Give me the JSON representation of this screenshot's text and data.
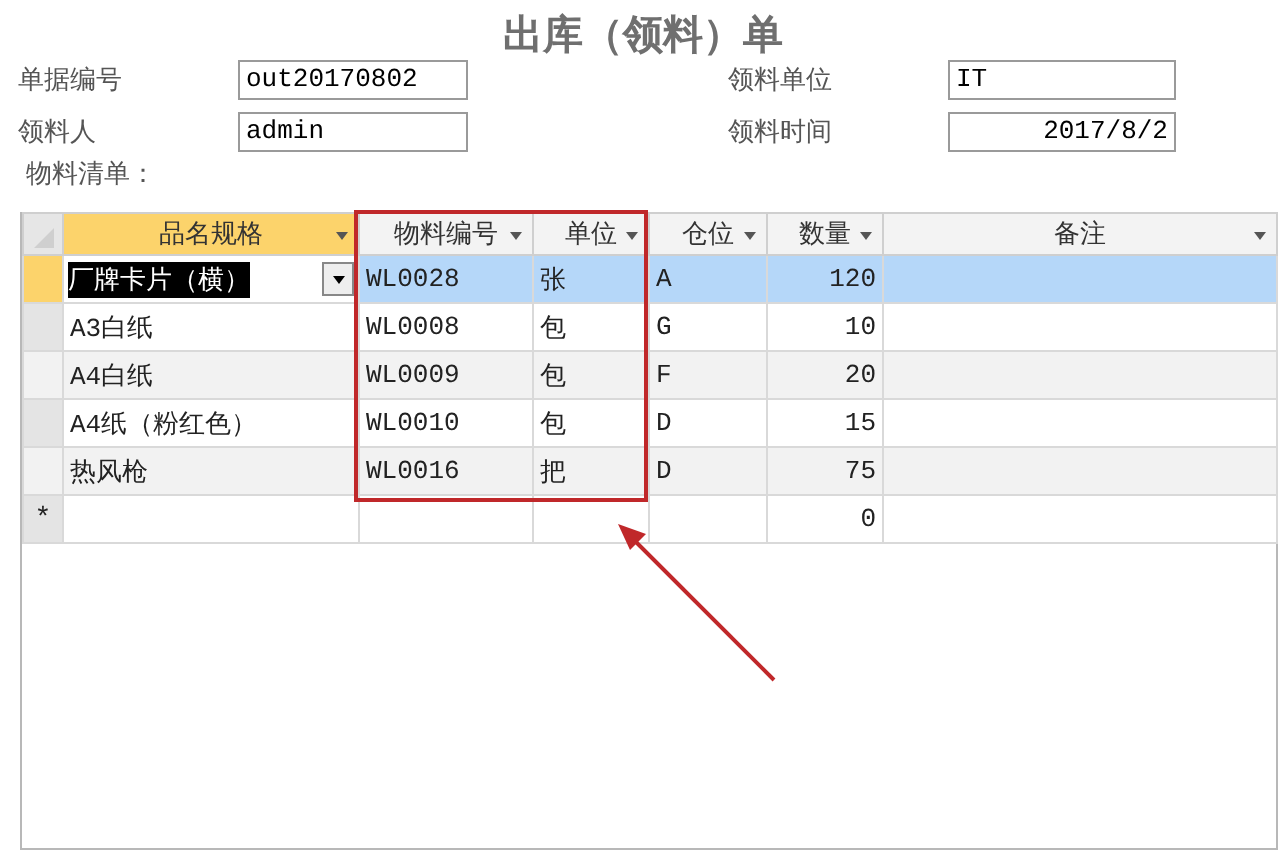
{
  "title": "出库（领料）单",
  "fields": [
    {
      "label": "单据编号",
      "value": "out20170802",
      "numeric": false
    },
    {
      "label": "领料单位",
      "value": "IT",
      "numeric": false
    },
    {
      "label": "领料人",
      "value": "admin",
      "numeric": false
    },
    {
      "label": "领料时间",
      "value": "2017/8/2",
      "numeric": true
    }
  ],
  "list_label": "物料清单：",
  "table": {
    "columns": [
      {
        "label": "品名规格",
        "active": true
      },
      {
        "label": "物料编号",
        "active": false
      },
      {
        "label": "单位",
        "active": false
      },
      {
        "label": "仓位",
        "active": false
      },
      {
        "label": "数量",
        "active": false
      },
      {
        "label": "备注",
        "active": false
      }
    ],
    "rows": [
      {
        "cells": [
          "厂牌卡片（横）",
          "WL0028",
          "张",
          "A",
          "120",
          ""
        ],
        "selected": true,
        "editing": true
      },
      {
        "cells": [
          "A3白纸",
          "WL0008",
          "包",
          "G",
          "10",
          ""
        ],
        "selected": false,
        "editing": false
      },
      {
        "cells": [
          "A4白纸",
          "WL0009",
          "包",
          "F",
          "20",
          ""
        ],
        "selected": false,
        "editing": false
      },
      {
        "cells": [
          "A4纸（粉红色）",
          "WL0010",
          "包",
          "D",
          "15",
          ""
        ],
        "selected": false,
        "editing": false
      },
      {
        "cells": [
          "热风枪",
          "WL0016",
          "把",
          "D",
          "75",
          ""
        ],
        "selected": false,
        "editing": false
      }
    ],
    "new_row": {
      "marker": "*",
      "cells": [
        "",
        "",
        "",
        "",
        "0",
        ""
      ]
    }
  }
}
